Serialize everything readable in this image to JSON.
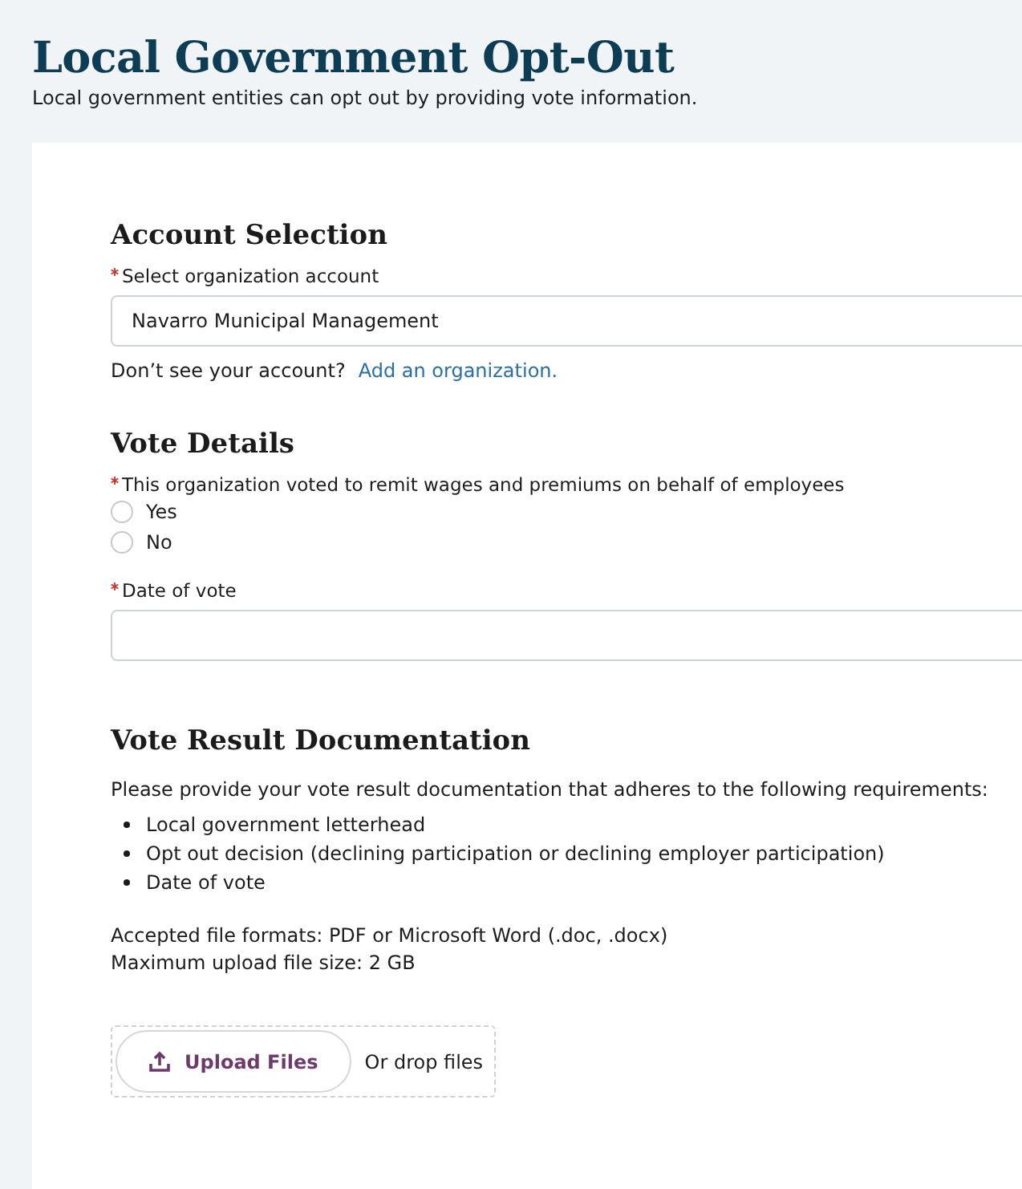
{
  "header": {
    "title": "Local Government Opt-Out",
    "subtitle": "Local government entities can opt out by providing vote information."
  },
  "account_section": {
    "heading": "Account Selection",
    "field": {
      "label": "Select organization account",
      "required": true,
      "value": "Navarro Municipal Management"
    },
    "hint": "Don’t see your account?",
    "link": "Add an organization."
  },
  "vote_section": {
    "heading": "Vote Details",
    "question": {
      "label": "This organization voted to remit wages and premiums on behalf of employees",
      "required": true,
      "options": [
        {
          "label": "Yes",
          "selected": false
        },
        {
          "label": "No",
          "selected": false
        }
      ]
    },
    "date_field": {
      "label": "Date of vote",
      "required": true
    }
  },
  "documentation_section": {
    "heading": "Vote Result Documentation",
    "intro": "Please provide your vote result documentation that adheres to the following requirements:",
    "requirements": [
      "Local government letterhead",
      "Opt out decision (declining participation or declining employer participation)",
      "Date of vote"
    ],
    "formats": "Accepted file formats: PDF or Microsoft Word (.doc, .docx)",
    "max_size": "Maximum upload file size: 2 GB",
    "upload_button": "Upload Files",
    "drop_text": "Or drop files"
  }
}
